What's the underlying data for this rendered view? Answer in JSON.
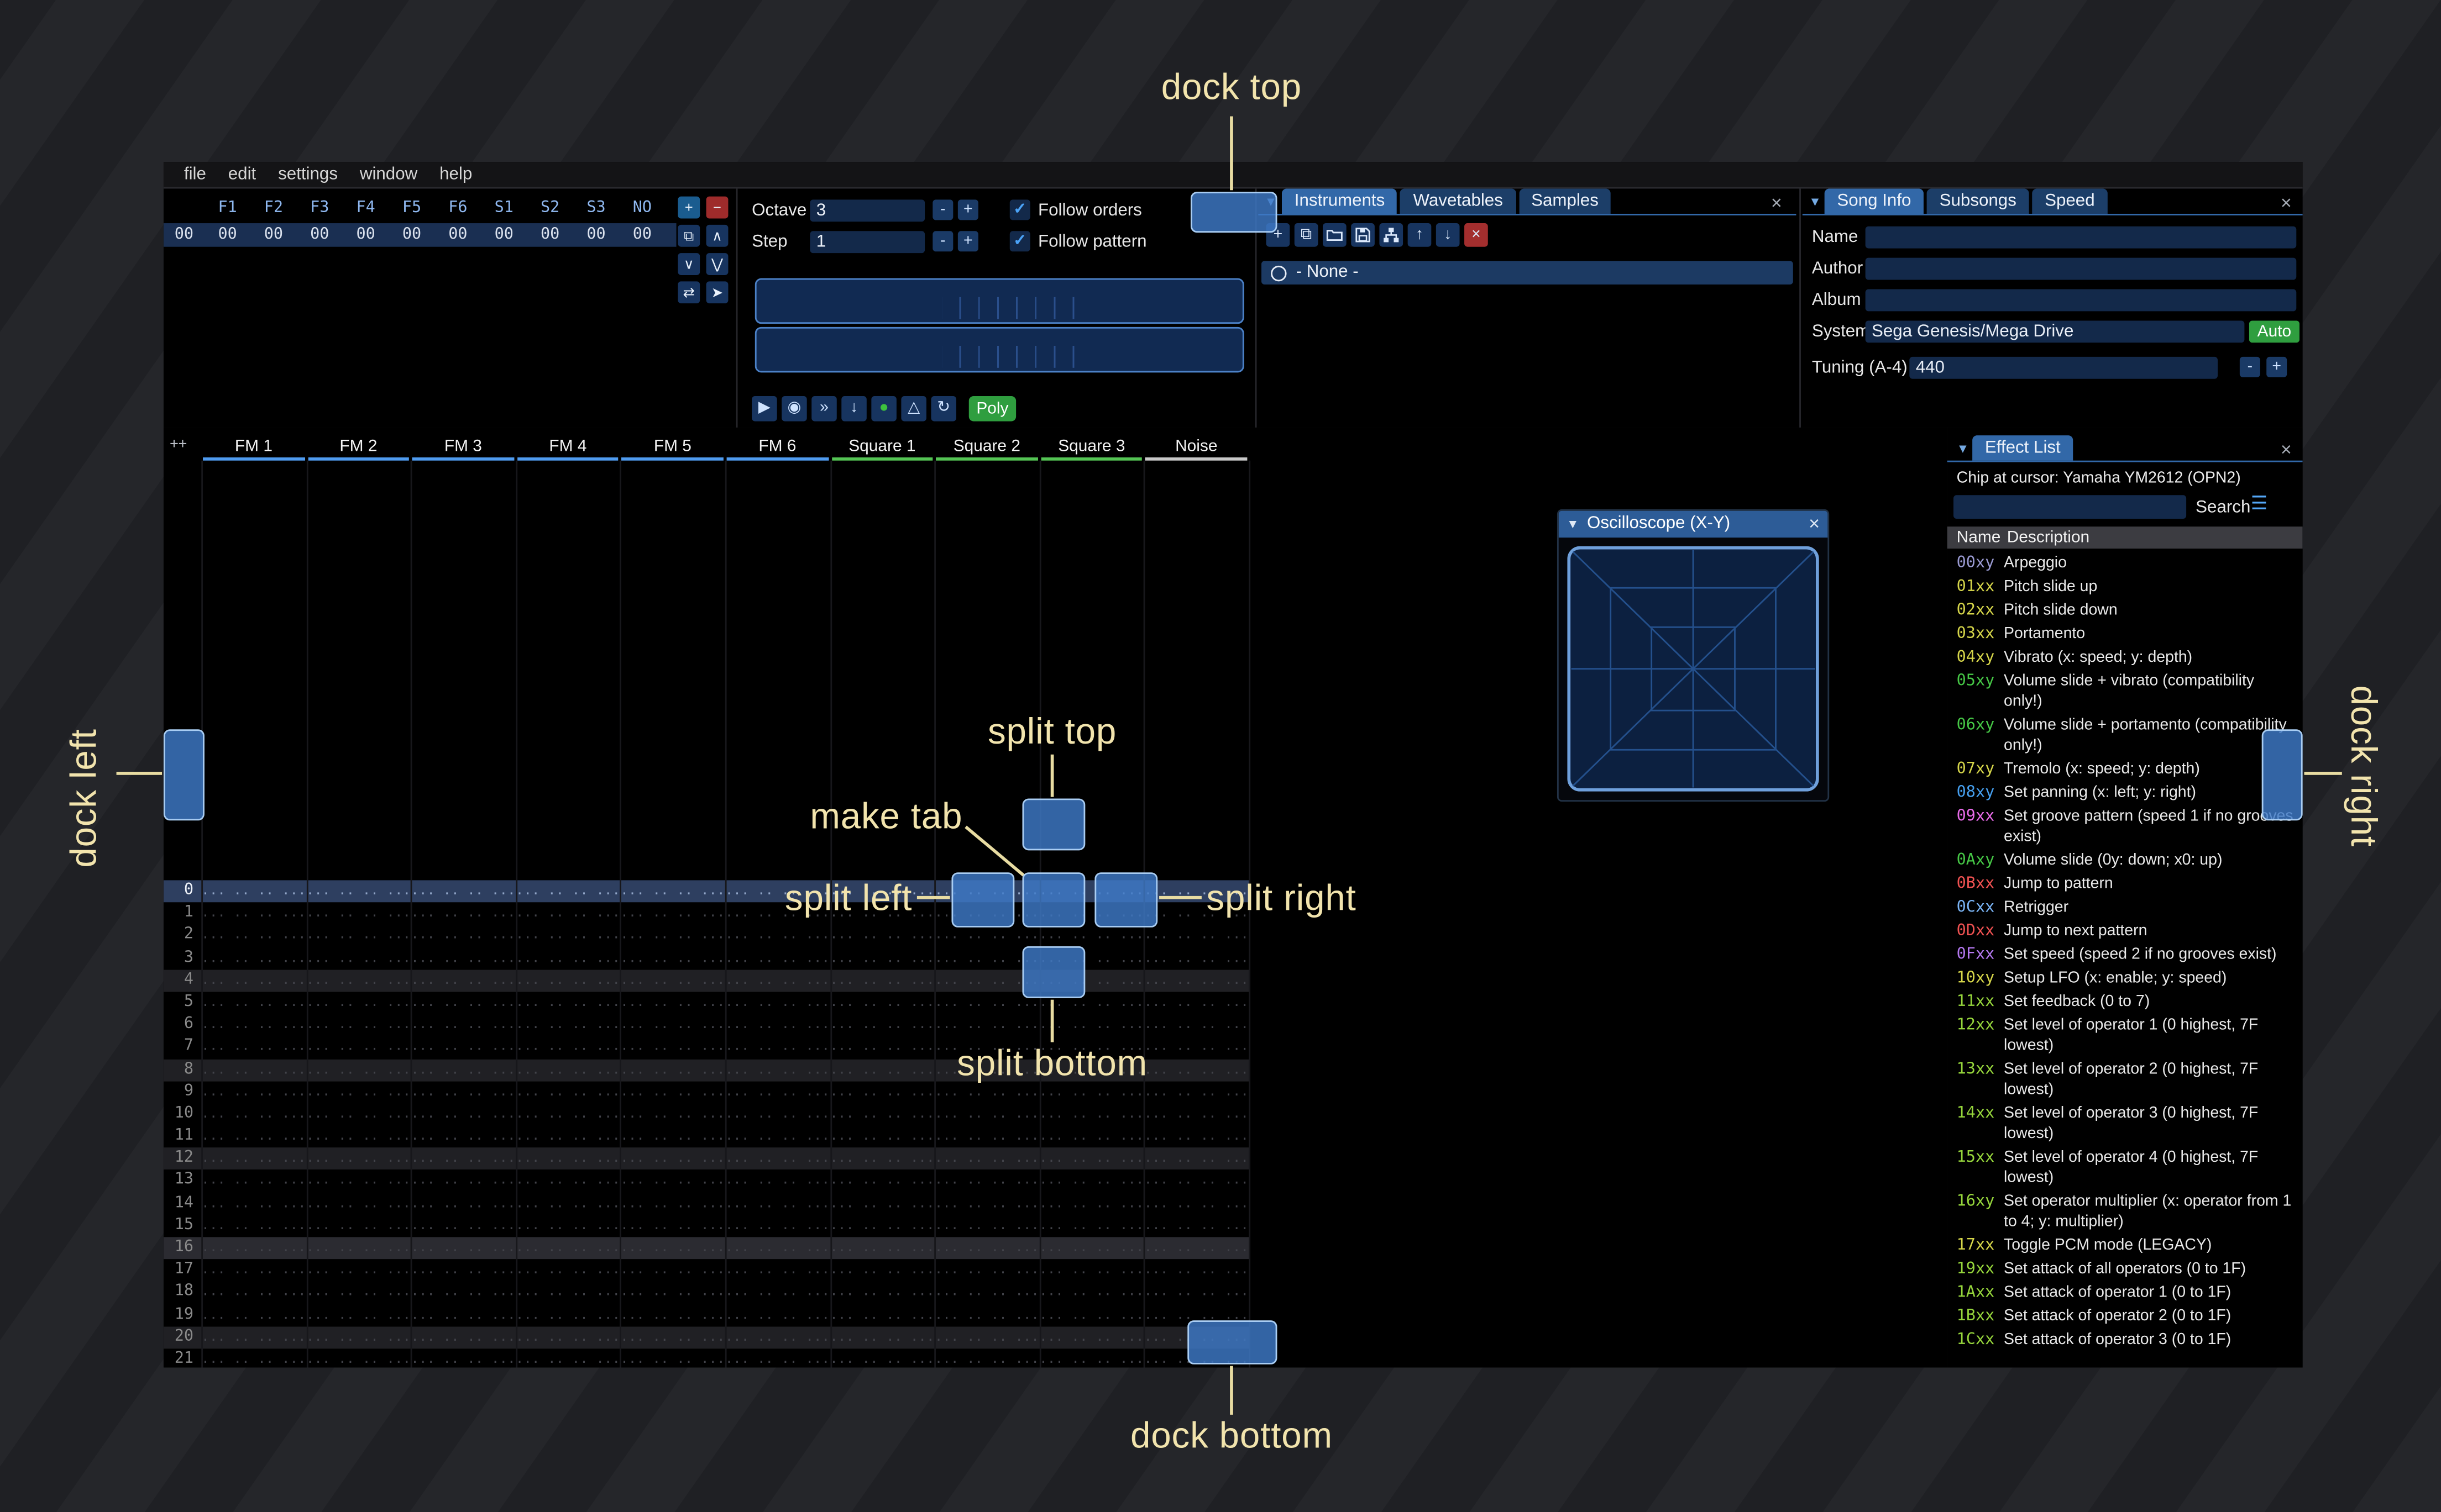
{
  "icons": {
    "collapse": "▼",
    "close": "×",
    "menu": "☰",
    "check": "✓"
  },
  "window": {
    "menu": [
      "file",
      "edit",
      "settings",
      "window",
      "help"
    ]
  },
  "orders": {
    "columns": [
      "F1",
      "F2",
      "F3",
      "F4",
      "F5",
      "F6",
      "S1",
      "S2",
      "S3",
      "NO"
    ],
    "row_index": "00",
    "row_values": [
      "00",
      "00",
      "00",
      "00",
      "00",
      "00",
      "00",
      "00",
      "00",
      "00"
    ],
    "buttons": [
      {
        "name": "add-order-button",
        "glyph": "+",
        "bg": "#1a5c8f"
      },
      {
        "name": "remove-order-button",
        "glyph": "−",
        "bg": "#9e2b2b"
      },
      {
        "name": "duplicate-order-button",
        "glyph": "⧉",
        "bg": "#17345f"
      },
      {
        "name": "move-order-up-button",
        "glyph": "∧",
        "bg": "#17345f"
      },
      {
        "name": "move-order-down-button",
        "glyph": "∨",
        "bg": "#17345f"
      },
      {
        "name": "duplicate-order-end-button",
        "glyph": "⋁",
        "bg": "#17345f"
      },
      {
        "name": "order-change-mode-button",
        "glyph": "⇄",
        "bg": "#17345f"
      },
      {
        "name": "order-edit-button",
        "glyph": "➤",
        "bg": "#17345f"
      }
    ]
  },
  "controls": {
    "octave_label": "Octave",
    "octave_value": "3",
    "step_label": "Step",
    "step_value": "1",
    "minus_glyph": "-",
    "plus_glyph": "+",
    "follow_orders_label": "Follow orders",
    "follow_pattern_label": "Follow pattern",
    "transport": [
      {
        "name": "play-button",
        "glyph": "▶",
        "color": "#cfe3ff"
      },
      {
        "name": "play-pattern-button",
        "glyph": "◉",
        "color": "#cfe3ff"
      },
      {
        "name": "step-row-button",
        "glyph": "»",
        "color": "#cfe3ff"
      },
      {
        "name": "stop-button",
        "glyph": "↓",
        "color": "#cfe3ff"
      },
      {
        "name": "record-button",
        "glyph": "●",
        "color": "#3ec23e"
      },
      {
        "name": "metronome-button",
        "glyph": "△",
        "color": "#cfe3ff"
      },
      {
        "name": "repeat-pattern-button",
        "glyph": "↻",
        "color": "#cfe3ff"
      }
    ],
    "poly_label": "Poly"
  },
  "instruments": {
    "tabs": [
      "Instruments",
      "Wavetables",
      "Samples"
    ],
    "active_tab": 0,
    "toolbar": [
      {
        "name": "add-instrument-button",
        "icon": "plus"
      },
      {
        "name": "duplicate-instrument-button",
        "icon": "copy"
      },
      {
        "name": "open-instrument-button",
        "icon": "folder"
      },
      {
        "name": "save-instrument-button",
        "icon": "save"
      },
      {
        "name": "instrument-editor-button",
        "icon": "sitemap"
      },
      {
        "name": "move-instrument-up-button",
        "icon": "arrow-up"
      },
      {
        "name": "move-instrument-down-button",
        "icon": "arrow-down"
      },
      {
        "name": "delete-instrument-button",
        "icon": "delete",
        "bg": "#a32e2e"
      }
    ],
    "list_item": "- None -"
  },
  "song_info": {
    "tabs": [
      "Song Info",
      "Subsongs",
      "Speed"
    ],
    "active_tab": 0,
    "name_label": "Name",
    "name_value": "",
    "author_label": "Author",
    "author_value": "",
    "album_label": "Album",
    "album_value": "",
    "system_label": "System",
    "system_value": "Sega Genesis/Mega Drive",
    "auto_label": "Auto",
    "tuning_label": "Tuning (A-4)",
    "tuning_value": "440"
  },
  "pattern": {
    "expand_label": "++",
    "channels": [
      {
        "name": "FM 1",
        "color": "#4f9bef"
      },
      {
        "name": "FM 2",
        "color": "#4f9bef"
      },
      {
        "name": "FM 3",
        "color": "#4f9bef"
      },
      {
        "name": "FM 4",
        "color": "#4f9bef"
      },
      {
        "name": "FM 5",
        "color": "#4f9bef"
      },
      {
        "name": "FM 6",
        "color": "#4f9bef"
      },
      {
        "name": "Square 1",
        "color": "#54c454"
      },
      {
        "name": "Square 2",
        "color": "#54c454"
      },
      {
        "name": "Square 3",
        "color": "#54c454"
      },
      {
        "name": "Noise",
        "color": "#c8c8c8"
      }
    ],
    "visible_rows": 22,
    "selected_row": 0,
    "empty_cell": "... .. .. ..."
  },
  "oscilloscope": {
    "title": "Oscilloscope (X-Y)"
  },
  "effect_list": {
    "tab_label": "Effect List",
    "chip_line": "Chip at cursor: Yamaha YM2612 (OPN2)",
    "search_label": "Search",
    "name_header": "Name",
    "description_header": "Description",
    "effects": [
      {
        "code": "00xy",
        "desc": "Arpeggio",
        "color": "#9a9ad2"
      },
      {
        "code": "01xx",
        "desc": "Pitch slide up",
        "color": "#d6d64a"
      },
      {
        "code": "02xx",
        "desc": "Pitch slide down",
        "color": "#d6d64a"
      },
      {
        "code": "03xx",
        "desc": "Portamento",
        "color": "#d6d64a"
      },
      {
        "code": "04xy",
        "desc": "Vibrato (x: speed; y: depth)",
        "color": "#d6d64a"
      },
      {
        "code": "05xy",
        "desc": "Volume slide + vibrato (compatibility only!)",
        "color": "#46c846"
      },
      {
        "code": "06xy",
        "desc": "Volume slide + portamento (compatibility only!)",
        "color": "#46c846"
      },
      {
        "code": "07xy",
        "desc": "Tremolo (x: speed; y: depth)",
        "color": "#d6d64a"
      },
      {
        "code": "08xy",
        "desc": "Set panning (x: left; y: right)",
        "color": "#46a0f0"
      },
      {
        "code": "09xx",
        "desc": "Set groove pattern (speed 1 if no grooves exist)",
        "color": "#e86be8"
      },
      {
        "code": "0Axy",
        "desc": "Volume slide (0y: down; x0: up)",
        "color": "#46c846"
      },
      {
        "code": "0Bxx",
        "desc": "Jump to pattern",
        "color": "#f05252"
      },
      {
        "code": "0Cxx",
        "desc": "Retrigger",
        "color": "#7ab4f5"
      },
      {
        "code": "0Dxx",
        "desc": "Jump to next pattern",
        "color": "#f05252"
      },
      {
        "code": "0Fxx",
        "desc": "Set speed (speed 2 if no grooves exist)",
        "color": "#b478f0"
      },
      {
        "code": "10xy",
        "desc": "Setup LFO (x: enable; y: speed)",
        "color": "#d6d64a"
      },
      {
        "code": "11xx",
        "desc": "Set feedback (0 to 7)",
        "color": "#96d63c"
      },
      {
        "code": "12xx",
        "desc": "Set level of operator 1 (0 highest, 7F lowest)",
        "color": "#96d63c"
      },
      {
        "code": "13xx",
        "desc": "Set level of operator 2 (0 highest, 7F lowest)",
        "color": "#96d63c"
      },
      {
        "code": "14xx",
        "desc": "Set level of operator 3 (0 highest, 7F lowest)",
        "color": "#96d63c"
      },
      {
        "code": "15xx",
        "desc": "Set level of operator 4 (0 highest, 7F lowest)",
        "color": "#96d63c"
      },
      {
        "code": "16xy",
        "desc": "Set operator multiplier (x: operator from 1 to 4; y: multiplier)",
        "color": "#96d63c"
      },
      {
        "code": "17xx",
        "desc": "Toggle PCM mode (LEGACY)",
        "color": "#d6d64a"
      },
      {
        "code": "19xx",
        "desc": "Set attack of all operators (0 to 1F)",
        "color": "#96d63c"
      },
      {
        "code": "1Axx",
        "desc": "Set attack of operator 1 (0 to 1F)",
        "color": "#96d63c"
      },
      {
        "code": "1Bxx",
        "desc": "Set attack of operator 2 (0 to 1F)",
        "color": "#96d63c"
      },
      {
        "code": "1Cxx",
        "desc": "Set attack of operator 3 (0 to 1F)",
        "color": "#96d63c"
      }
    ]
  },
  "overlay": {
    "labels": {
      "dock_top": "dock top",
      "dock_bottom": "dock bottom",
      "dock_left": "dock left",
      "dock_right": "dock right",
      "split_top": "split top",
      "split_bottom": "split bottom",
      "split_left": "split left",
      "split_right": "split right",
      "make_tab": "make tab"
    }
  }
}
